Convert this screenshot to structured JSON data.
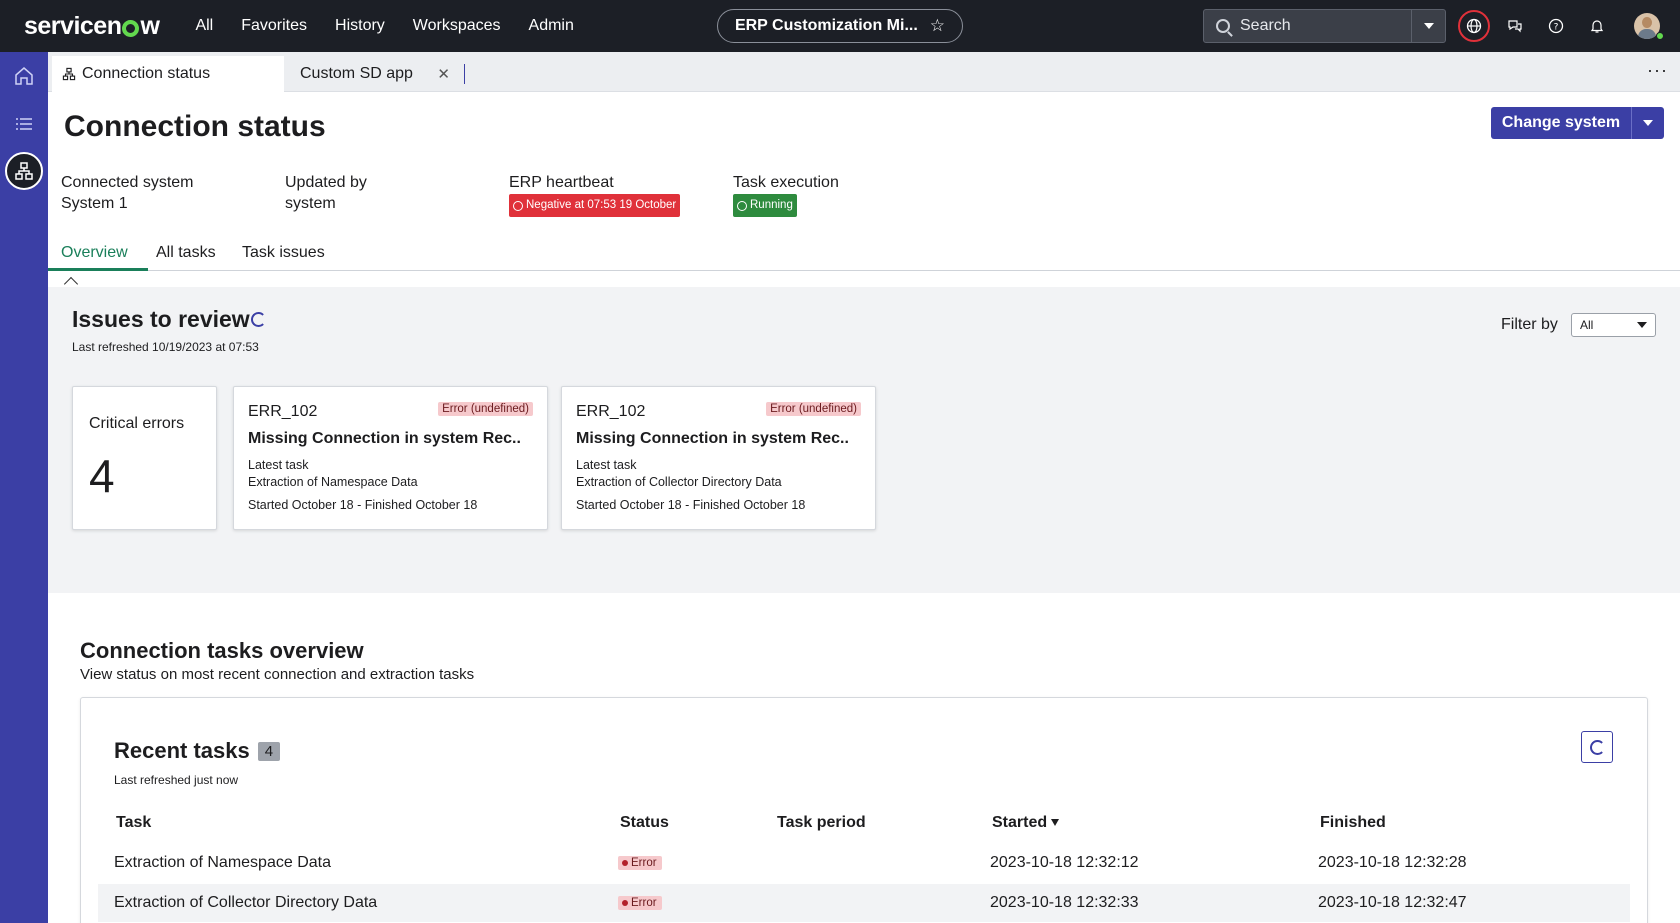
{
  "topbar": {
    "logo": "servicenow",
    "nav": [
      "All",
      "Favorites",
      "History",
      "Workspaces",
      "Admin"
    ],
    "app_pill": "ERP Customization Mi...",
    "search_placeholder": "Search"
  },
  "tabs": {
    "active": "Connection status",
    "inactive": "Custom SD app"
  },
  "header": {
    "title": "Connection status",
    "change_button": "Change system"
  },
  "meta": {
    "connected_label": "Connected system",
    "connected_value": "System 1",
    "updated_label": "Updated by",
    "updated_value": "system",
    "heartbeat_label": "ERP heartbeat",
    "heartbeat_value": "Negative at 07:53 19 October",
    "execution_label": "Task execution",
    "execution_value": "Running"
  },
  "subtabs": [
    "Overview",
    "All tasks",
    "Task issues"
  ],
  "issues": {
    "title": "Issues to review",
    "last_refreshed": "Last refreshed 10/19/2023 at 07:53",
    "filter_label": "Filter by",
    "filter_value": "All",
    "critical_label": "Critical errors",
    "critical_value": "4",
    "cards": [
      {
        "code": "ERR_102",
        "badge": "Error (undefined)",
        "title": "Missing Connection in system Rec..",
        "latest_label": "Latest task",
        "latest_task": "Extraction of Namespace Data",
        "period": "Started October 18 - Finished October 18"
      },
      {
        "code": "ERR_102",
        "badge": "Error (undefined)",
        "title": "Missing Connection in system Rec..",
        "latest_label": "Latest task",
        "latest_task": "Extraction of Collector Directory Data",
        "period": "Started October 18 - Finished October 18"
      }
    ]
  },
  "overview": {
    "title": "Connection tasks overview",
    "subtitle": "View status on most recent connection and extraction tasks",
    "recent_title": "Recent tasks",
    "recent_count": "4",
    "recent_refreshed": "Last refreshed just now",
    "columns": [
      "Task",
      "Status",
      "Task period",
      "Started",
      "Finished"
    ],
    "rows": [
      {
        "task": "Extraction of Namespace Data",
        "status": "Error",
        "period": "",
        "started": "2023-10-18 12:32:12",
        "finished": "2023-10-18 12:32:28"
      },
      {
        "task": "Extraction of Collector Directory Data",
        "status": "Error",
        "period": "",
        "started": "2023-10-18 12:32:33",
        "finished": "2023-10-18 12:32:47"
      }
    ]
  },
  "colors": {
    "topbar": "#1c1f26",
    "rail": "#3b3fa5",
    "primary": "#3b3fa5",
    "active_tab": "#1a7f5a",
    "error": "#e0313a",
    "running": "#2e8b3e"
  }
}
